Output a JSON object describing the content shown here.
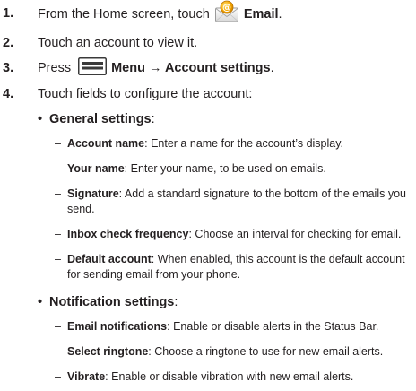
{
  "steps": [
    {
      "num": "1.",
      "text_before": "From the Home screen, touch",
      "icon": "email-app-icon",
      "text_bold": "Email",
      "text_after": "."
    },
    {
      "num": "2.",
      "text": "Touch an account to view it."
    },
    {
      "num": "3.",
      "text_before": "Press",
      "icon": "menu-key-icon",
      "text_bold": "Menu → Account settings",
      "text_after": "."
    },
    {
      "num": "4.",
      "text": "Touch fields to configure the account:"
    }
  ],
  "sections": [
    {
      "bullet": "•",
      "title": "General settings",
      "colon": ":",
      "items": [
        {
          "name": "Account name",
          "desc": ": Enter a name for the account’s display."
        },
        {
          "name": "Your name",
          "desc": ": Enter your name, to be used on emails."
        },
        {
          "name": "Signature",
          "desc": ": Add a standard signature to the bottom of the emails you send."
        },
        {
          "name": "Inbox check frequency",
          "desc": ": Choose an interval for checking for email."
        },
        {
          "name": "Default account",
          "desc": ": When enabled, this account is the default account for sending email from your phone."
        }
      ]
    },
    {
      "bullet": "•",
      "title": "Notification settings",
      "colon": ":",
      "items": [
        {
          "name": "Email notifications",
          "desc": ": Enable or disable alerts in the Status Bar."
        },
        {
          "name": "Select ringtone",
          "desc": ": Choose a ringtone to use for new email alerts."
        },
        {
          "name": "Vibrate",
          "desc": ": Enable or disable vibration with new email alerts."
        }
      ]
    }
  ],
  "dash": "–",
  "colors": {
    "text": "#231f20",
    "email_icon_envelope": "#f4f4f4",
    "email_icon_badge": "#f6a800",
    "menu_icon_fill": "#3a3a3a"
  }
}
